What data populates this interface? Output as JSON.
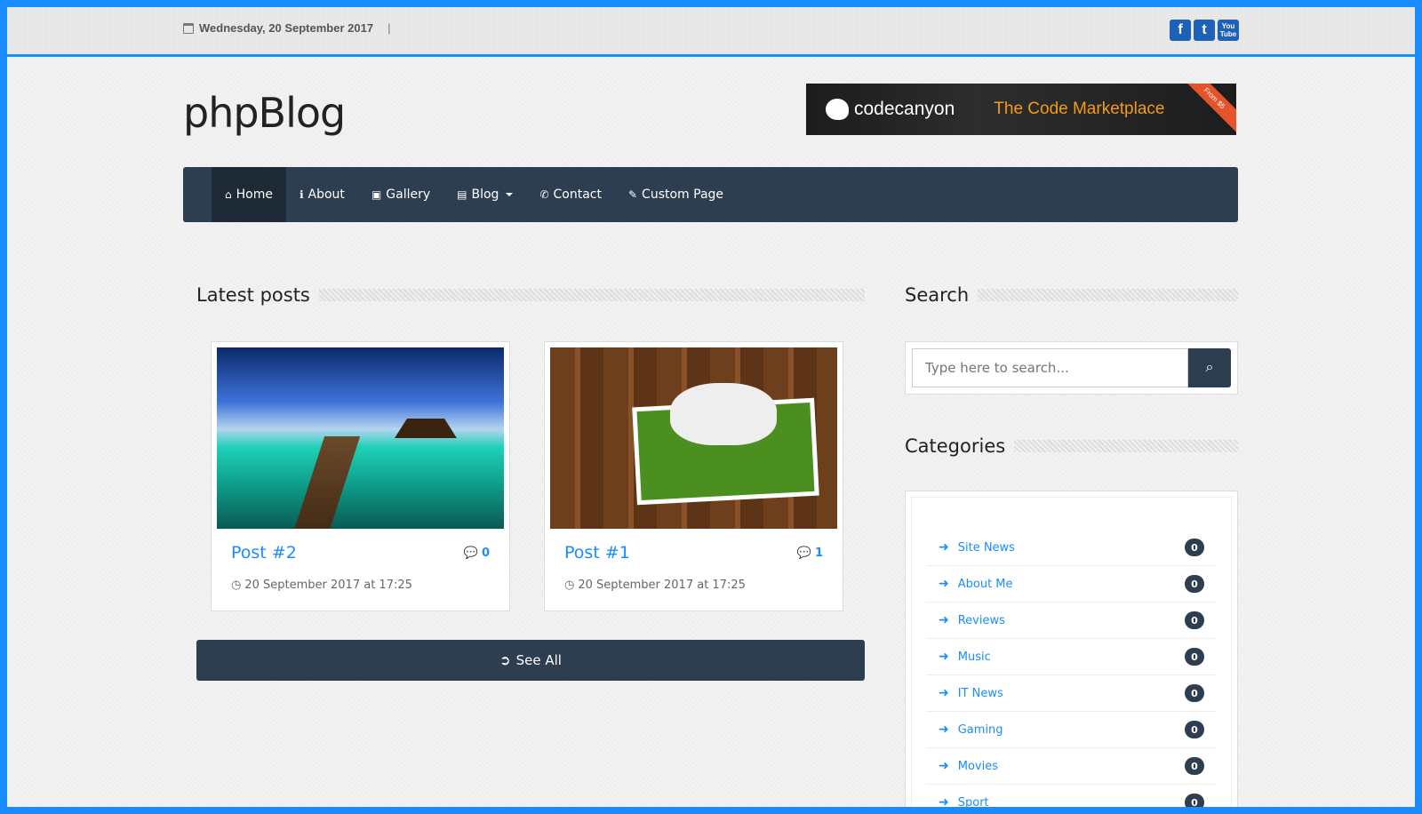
{
  "topbar": {
    "date": "Wednesday, 20 September 2017",
    "separator": "|",
    "social": [
      {
        "icon": "facebook-icon",
        "glyph": "f"
      },
      {
        "icon": "twitter-icon",
        "glyph": "t"
      },
      {
        "icon": "youtube-icon",
        "glyph": "You Tube"
      }
    ]
  },
  "header": {
    "logo": "phpBlog",
    "banner": {
      "brand": "codecanyon",
      "tagline": "The Code Marketplace",
      "ribbon": "From $5"
    }
  },
  "nav": {
    "items": [
      {
        "label": "Home",
        "icon": "home-icon",
        "glyph": "⌂"
      },
      {
        "label": "About",
        "icon": "info-icon",
        "glyph": "ℹ"
      },
      {
        "label": "Gallery",
        "icon": "image-icon",
        "glyph": "▣"
      },
      {
        "label": "Blog",
        "icon": "file-icon",
        "glyph": "▤"
      },
      {
        "label": "Contact",
        "icon": "phone-icon",
        "glyph": "✆"
      },
      {
        "label": "Custom Page",
        "icon": "pencil-icon",
        "glyph": "✎"
      }
    ]
  },
  "latest": {
    "title": "Latest posts",
    "posts": [
      {
        "title": "Post #2",
        "comments": "0",
        "date": "20 September 2017 at 17:25"
      },
      {
        "title": "Post #1",
        "comments": "1",
        "date": "20 September 2017 at 17:25"
      }
    ],
    "see_all": "See All"
  },
  "sidebar": {
    "search_title": "Search",
    "search_placeholder": "Type here to search...",
    "categories_title": "Categories",
    "categories": [
      {
        "label": "Site News",
        "count": "0"
      },
      {
        "label": "About Me",
        "count": "0"
      },
      {
        "label": "Reviews",
        "count": "0"
      },
      {
        "label": "Music",
        "count": "0"
      },
      {
        "label": "IT News",
        "count": "0"
      },
      {
        "label": "Gaming",
        "count": "0"
      },
      {
        "label": "Movies",
        "count": "0"
      },
      {
        "label": "Sport",
        "count": "0"
      }
    ]
  },
  "colors": {
    "accent": "#1a8cff",
    "nav_bg": "#2c3e50"
  }
}
